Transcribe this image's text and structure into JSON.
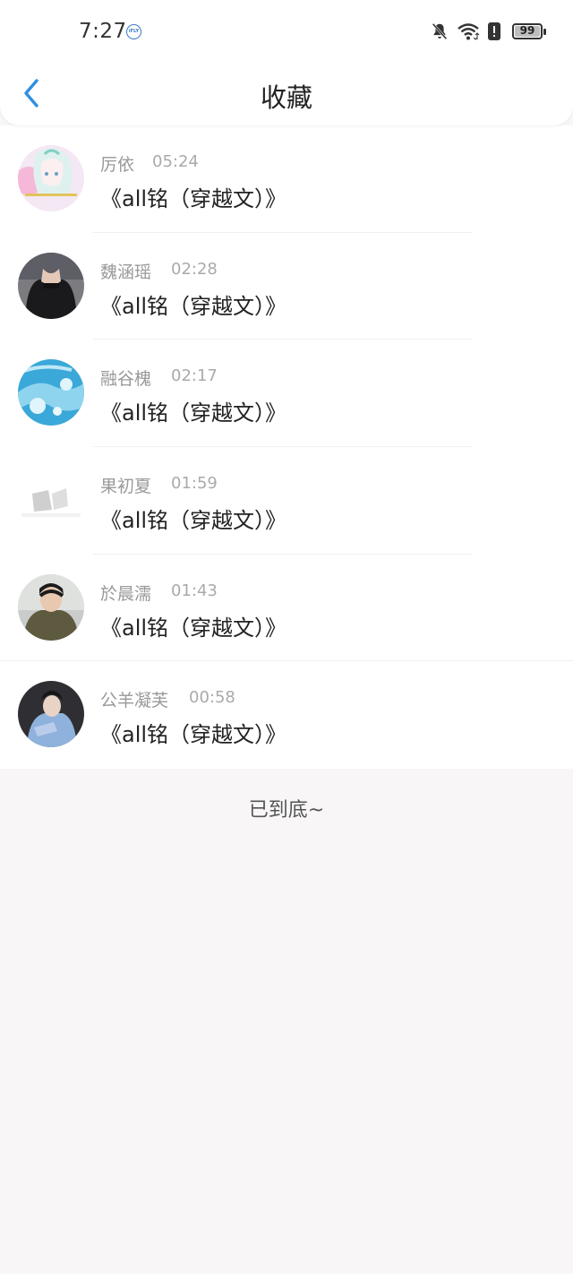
{
  "status_bar": {
    "time": "7:27",
    "ifly_label": "iFLY",
    "battery": "99",
    "battery_level": 0.99
  },
  "header": {
    "title": "收藏"
  },
  "favorites": [
    {
      "user": "厉依",
      "time": "05:24",
      "book": "《all铭（穿越文）》"
    },
    {
      "user": "魏涵瑶",
      "time": "02:28",
      "book": "《all铭（穿越文）》"
    },
    {
      "user": "融谷槐",
      "time": "02:17",
      "book": "《all铭（穿越文）》"
    },
    {
      "user": "果初夏",
      "time": "01:59",
      "book": "《all铭（穿越文）》"
    },
    {
      "user": "於晨濡",
      "time": "01:43",
      "book": "《all铭（穿越文）》"
    },
    {
      "user": "公羊凝芙",
      "time": "00:58",
      "book": "《all铭（穿越文）》"
    }
  ],
  "footer": {
    "end_text": "已到底~"
  },
  "colors": {
    "accent": "#2f8fe0",
    "background": "#f8f6f7",
    "card": "#ffffff"
  }
}
